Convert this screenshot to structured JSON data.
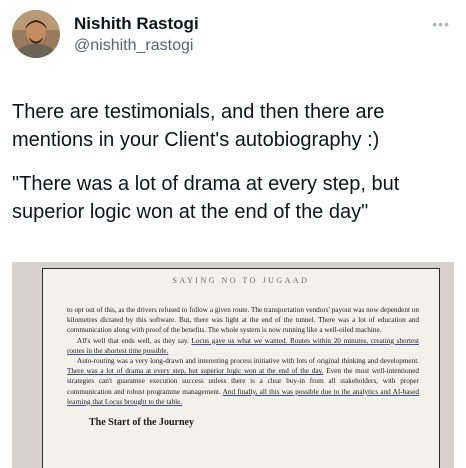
{
  "author": {
    "display_name": "Nishith Rastogi",
    "handle": "@nishith_rastogi",
    "more_icon": "more-horizontal-icon"
  },
  "tweet": {
    "paragraph_1": "There are testimonials, and then there are mentions in your Client's autobiography :)",
    "paragraph_2": "\"There was a lot of drama at every step, but superior logic won at the end of the day\""
  },
  "book_page": {
    "running_head": "SAYING NO TO JUGAAD",
    "para_1": "to opt out of this, as the drivers refused to follow a given route. The transportation vendors' payout was now dependent on kilometres dictated by this software. But, there was light at the end of the tunnel. There was a lot of education and communication along with proof of the benefits. The whole system is now running like a well-oiled machine.",
    "para_2_start": "All's well that ends well, as they say. ",
    "para_2_hl": "Locus gave us what we wanted. Routes within 20 minutes, creating shortest routes in the shortest time possible.",
    "para_3_start": "Auto-routing was a very long-drawn and interesting process initiative with lots of original thinking and development. ",
    "para_3_hl": "There was a lot of drama at every step, but superior logic won at the end of the day.",
    "para_3_mid": " Even the most well-intentioned strategies can't guarantee execution success unless there is a clear buy-in from all stakeholders, with proper communication and robust programme management. ",
    "para_3_hl2": "And finally, all this was possible due to the analytics and AI-based learning that Locus brought to the table.",
    "section_heading": "The Start of the Journey"
  }
}
